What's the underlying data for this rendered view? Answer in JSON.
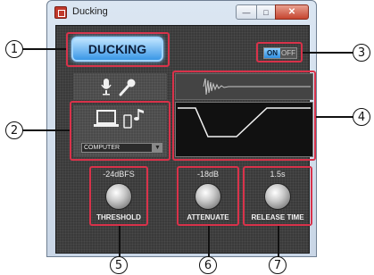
{
  "window": {
    "title": "Ducking"
  },
  "ducking_button": {
    "label": "DUCKING"
  },
  "toggle": {
    "on_label": "ON",
    "off_label": "OFF",
    "state": "on"
  },
  "source": {
    "selected": "COMPUTER"
  },
  "knobs": [
    {
      "value": "-24dBFS",
      "label": "THRESHOLD"
    },
    {
      "value": "-18dB",
      "label": "ATTENUATE"
    },
    {
      "value": "1.5s",
      "label": "RELEASE TIME"
    }
  ],
  "callouts": [
    "1",
    "2",
    "3",
    "4",
    "5",
    "6",
    "7"
  ],
  "colors": {
    "highlight": "#d8324a",
    "button_blue": "#3a97e6",
    "panel": "#3a3a3a"
  }
}
